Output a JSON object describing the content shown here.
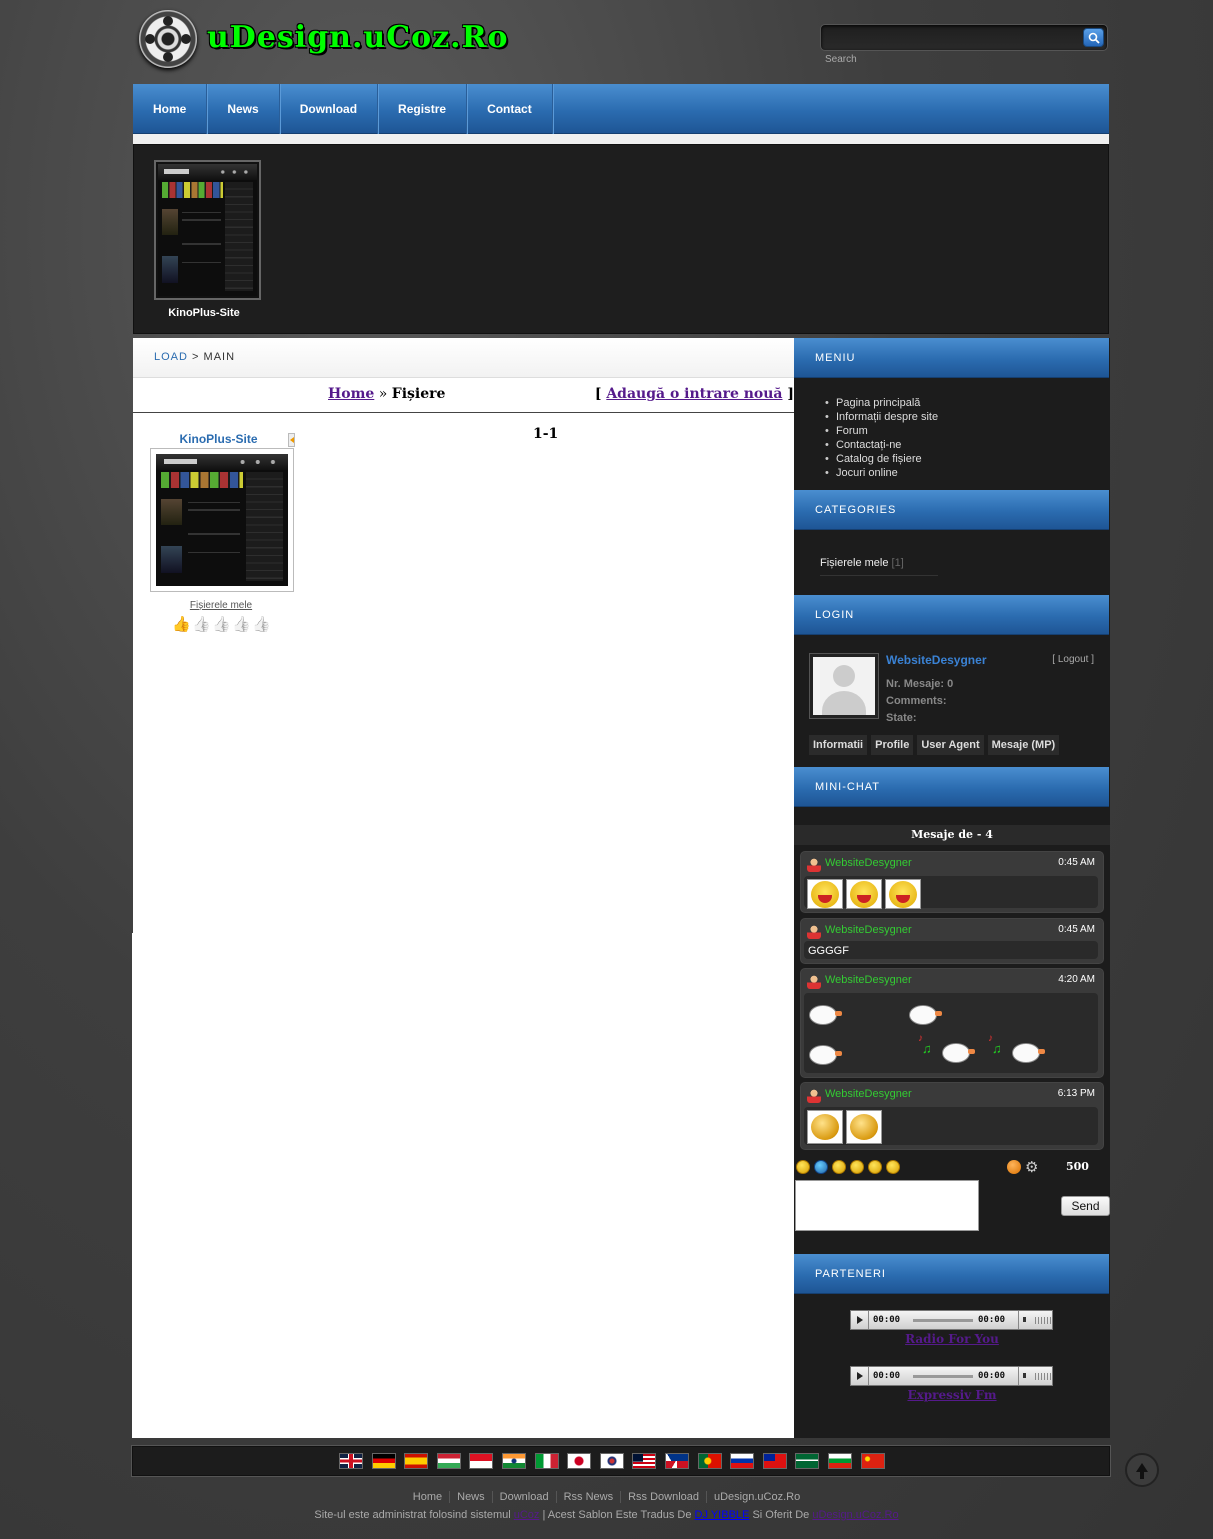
{
  "header": {
    "logo_text": "uDesign.uCoz.Ro",
    "search": {
      "placeholder": "",
      "label": "Search"
    }
  },
  "nav": [
    "Home",
    "News",
    "Download",
    "Registre",
    "Contact"
  ],
  "banner": {
    "label": "KinoPlus-Site"
  },
  "breadcrumb": {
    "link": "LOAD",
    "separator": ">",
    "current": "MAIN"
  },
  "path": {
    "home": "Home",
    "sep": "»",
    "current": "Fișiere",
    "add_open": "[",
    "add_link": "Adaugă o intrare nouă",
    "add_close": "]"
  },
  "pager": "1-1",
  "entry": {
    "title": "KinoPlus-Site",
    "category": "Fișierele mele",
    "rating": 1,
    "rating_max": 5
  },
  "sidebar": {
    "menu_title": "MENIU",
    "menu_items": [
      "Pagina principală",
      "Informații despre site",
      "Forum",
      "Contactați-ne",
      "Catalog de fișiere",
      "Jocuri online"
    ],
    "categories_title": "CATEGORIES",
    "category": {
      "name": "Fișierele mele",
      "count": "[1]"
    },
    "login_title": "LOGIN",
    "user": {
      "name": "WebsiteDesygner",
      "logout": "[ Logout ]",
      "messages": "Nr. Mesaje: 0",
      "comments": "Comments:",
      "state": "State:"
    },
    "user_tabs": [
      "Informatii",
      "Profile",
      "User Agent",
      "Mesaje (MP)"
    ],
    "chat_title": "MINI-CHAT",
    "chat_header": "Mesaje de - 4",
    "messages": [
      {
        "user": "WebsiteDesygner",
        "time": "0:45 AM"
      },
      {
        "user": "WebsiteDesygner",
        "time": "0:45 AM",
        "text": "GGGGF"
      },
      {
        "user": "WebsiteDesygner",
        "time": "4:20 AM"
      },
      {
        "user": "WebsiteDesygner",
        "time": "6:13 PM"
      }
    ],
    "chat_counter": "500",
    "send_label": "Send",
    "partners_title": "PARTENERI",
    "radios": [
      {
        "time1": "00:00",
        "time2": "00:00",
        "name": "Radio For You"
      },
      {
        "time1": "00:00",
        "time2": "00:00",
        "name": "Expressiv Fm"
      }
    ]
  },
  "footer": {
    "links": [
      "Home",
      "News",
      "Download",
      "Rss News",
      "Rss Download",
      "uDesign.uCoz.Ro"
    ],
    "credit_pre": "Site-ul este administrat folosind sistemul",
    "credit_link1": "uCoz",
    "credit_mid": "| Acest Sablon Este Tradus De",
    "credit_link2": "DJ YIBBLE",
    "credit_mid2": "Si Oferit De",
    "credit_link3": "uDesign.uCoz.Ro"
  },
  "colors": {
    "accent": "#2b6cb0",
    "chat_user": "#33cc33",
    "link_visited": "#551a8b"
  }
}
